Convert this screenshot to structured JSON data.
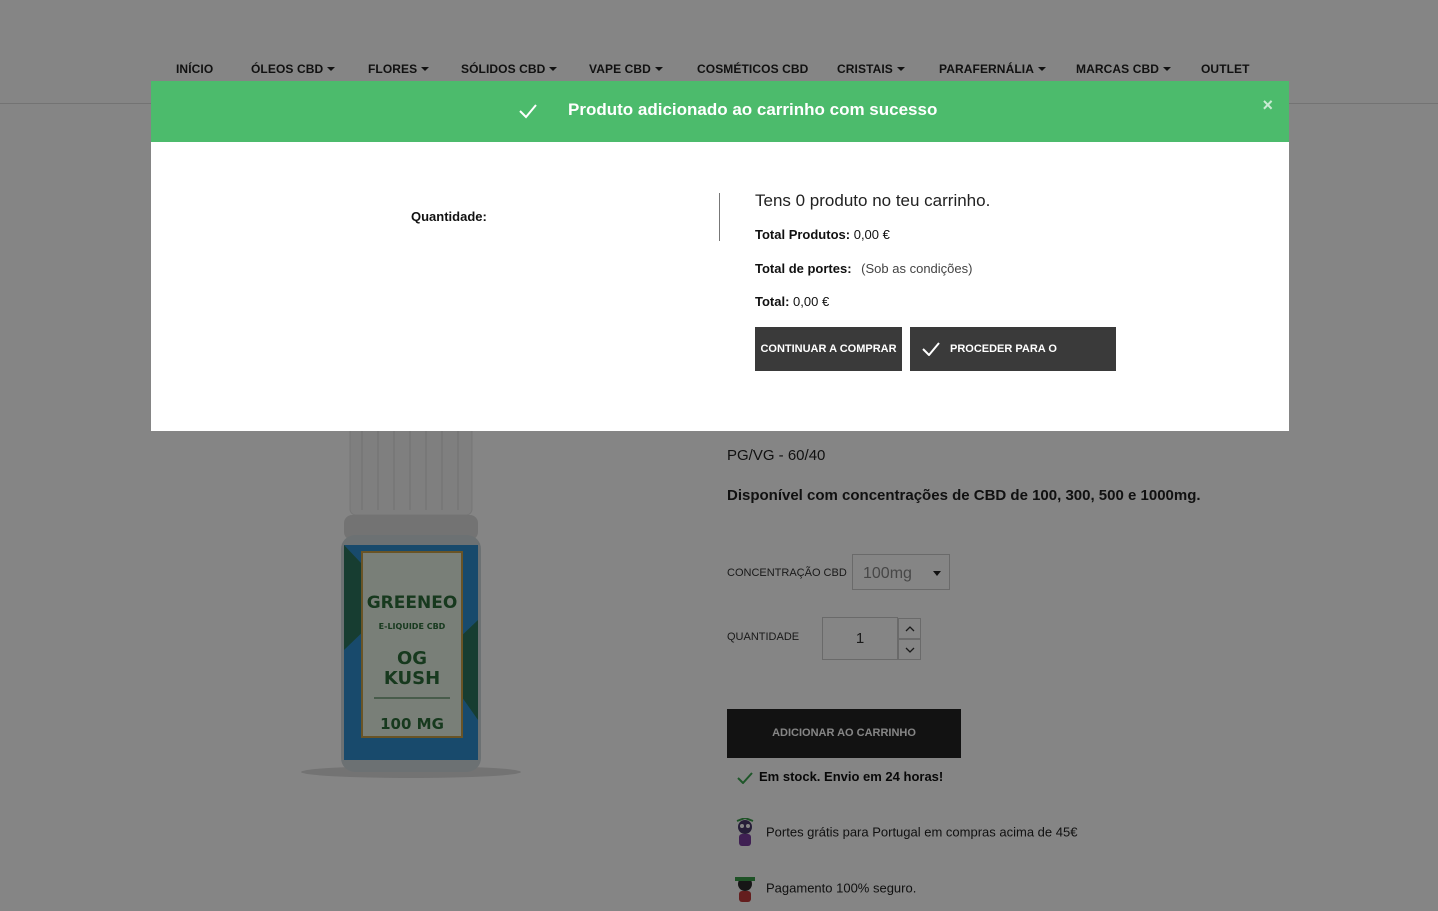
{
  "nav": {
    "items": [
      {
        "label": "INÍCIO",
        "dropdown": false
      },
      {
        "label": "ÓLEOS CBD",
        "dropdown": true
      },
      {
        "label": "FLORES",
        "dropdown": true
      },
      {
        "label": "SÓLIDOS CBD",
        "dropdown": true
      },
      {
        "label": "VAPE CBD",
        "dropdown": true
      },
      {
        "label": "COSMÉTICOS CBD",
        "dropdown": false
      },
      {
        "label": "CRISTAIS",
        "dropdown": true
      },
      {
        "label": "PARAFERNÁLIA",
        "dropdown": true
      },
      {
        "label": "MARCAS CBD",
        "dropdown": true
      },
      {
        "label": "OUTLET",
        "dropdown": false
      }
    ]
  },
  "product": {
    "image_text": {
      "brand": "GREENEO",
      "subtitle": "E-LIQUIDE CBD",
      "name_line1": "OG",
      "name_line2": "KUSH",
      "dose": "100 MG"
    },
    "ratio": "PG/VG - 60/40",
    "availability_text": "Disponível com concentrações de CBD de 100, 300, 500 e 1000mg.",
    "concentration_label": "CONCENTRAÇÃO CBD",
    "concentration_value": "100mg",
    "quantity_label": "QUANTIDADE",
    "quantity_value": "1",
    "add_to_cart_label": "ADICIONAR AO CARRINHO",
    "stock_text": "Em stock. Envio em 24 horas!",
    "info": [
      "Portes grátis para Portugal em compras acima de 45€",
      "Pagamento 100% seguro."
    ]
  },
  "modal": {
    "title": "Produto adicionado ao carrinho com sucesso",
    "close_label": "×",
    "quantity_label": "Quantidade:",
    "cart_count_text": "Tens 0 produto no teu carrinho.",
    "total_products_label": "Total Produtos:",
    "total_products_value": "0,00 €",
    "shipping_label": "Total de portes:",
    "shipping_value": "(Sob as condições)",
    "total_label": "Total:",
    "total_value": "0,00 €",
    "continue_label": "CONTINUAR A COMPRAR",
    "checkout_label": "PROCEDER PARA O CHECKOUT"
  },
  "colors": {
    "success_green": "#4cbb6c",
    "dark_button": "#3a3a3a"
  }
}
